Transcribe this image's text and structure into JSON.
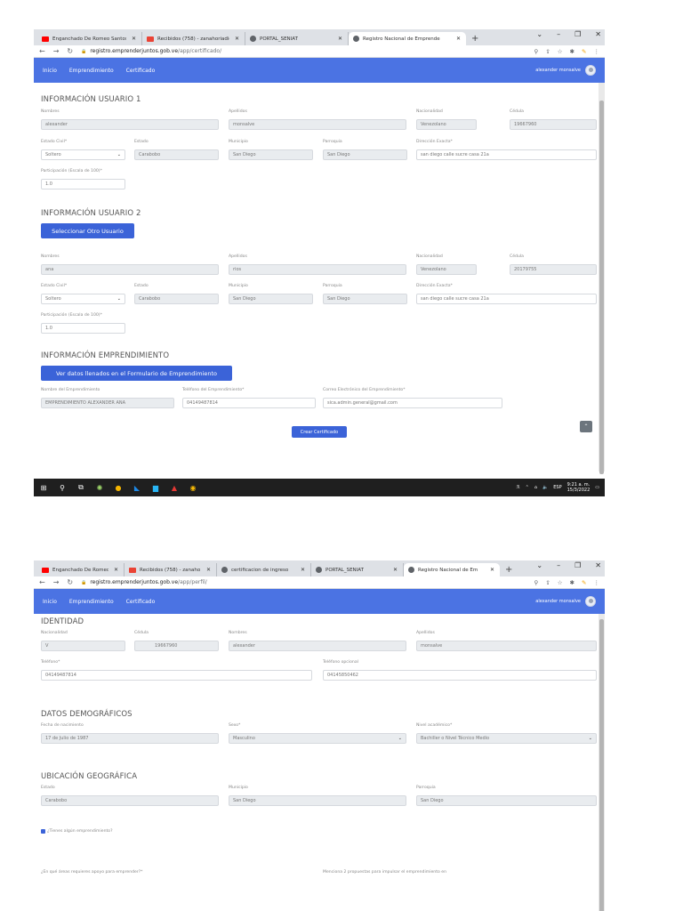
{
  "screenshot1": {
    "tabs": [
      {
        "title": "Enganchado De Romeo Santos",
        "icon": "youtube-icon",
        "color": "#ff0000",
        "active": false
      },
      {
        "title": "Recibidos (758) - zanahoriadigit",
        "icon": "gmail-icon",
        "color": "#ea4335",
        "active": false
      },
      {
        "title": "PORTAL_SENIAT",
        "icon": "globe-icon",
        "color": "#5f6368",
        "active": false
      },
      {
        "title": "Registro Nacional de Emprende",
        "icon": "globe-icon",
        "color": "#5f6368",
        "active": true
      }
    ],
    "url_host": "registro.emprenderjuntos.gob.ve",
    "url_path": "/app/certificado/",
    "nav": [
      "Inicio",
      "Emprendimiento",
      "Certificado"
    ],
    "user_name": "alexander monsalve",
    "section_user1": "INFORMACIÓN USUARIO 1",
    "section_user2": "INFORMACIÓN USUARIO 2",
    "section_emp": "INFORMACIÓN EMPRENDIMIENTO",
    "labels": {
      "nombres": "Nombres",
      "apellidos": "Apellidos",
      "nacionalidad": "Nacionalidad",
      "cedula": "Cédula",
      "estado_civil": "Estado Civil*",
      "estado": "Estado",
      "municipio": "Municipio",
      "parroquia": "Parroquia",
      "direccion": "Dirección Exacta*",
      "participacion": "Participación (Escala de 100)*",
      "nombre_emp": "Nombre del Emprendimiento",
      "telefono_emp": "Teléfono del Emprendimiento*",
      "correo_emp": "Correo Electrónico del Emprendimiento*"
    },
    "user1": {
      "nombres": "alexander",
      "apellidos": "monsalve",
      "nacionalidad": "Venezolano",
      "cedula": "19667960",
      "estado_civil": "Soltero",
      "estado": "Carabobo",
      "municipio": "San Diego",
      "parroquia": "San Diego",
      "direccion": "san diego calle sucre casa 21a",
      "participacion": "1.0"
    },
    "user2": {
      "nombres": "ana",
      "apellidos": "rios",
      "nacionalidad": "Venezolano",
      "cedula": "20179755",
      "estado_civil": "Soltero",
      "estado": "Carabobo",
      "municipio": "San Diego",
      "parroquia": "San Diego",
      "direccion": "san diego calle sucre casa 21a",
      "participacion": "1.0"
    },
    "btn_select_user": "Seleccionar Otro Usuario",
    "btn_view_form": "Ver datos llenados en el Formulario de Emprendimiento",
    "emp": {
      "nombre": "EMPRENDIMIENTO ALEXANDER ANA",
      "telefono": "04149487814",
      "correo": "sica.admin.general@gmail.com"
    },
    "btn_create_cert": "Crear Certificado",
    "tray": {
      "lang": "ESP",
      "time": "9:21 a. m.",
      "date": "15/3/2022"
    }
  },
  "screenshot2": {
    "tabs": [
      {
        "title": "Enganchado De Romeo Santos",
        "icon": "youtube-icon",
        "color": "#ff0000",
        "active": false
      },
      {
        "title": "Recibidos (758) - zanaho",
        "icon": "gmail-icon",
        "color": "#ea4335",
        "active": false
      },
      {
        "title": "certificacion de ingreso",
        "icon": "globe-icon",
        "color": "#5f6368",
        "active": false
      },
      {
        "title": "PORTAL_SENIAT",
        "icon": "globe-icon",
        "color": "#5f6368",
        "active": false
      },
      {
        "title": "Registro Nacional de Em",
        "icon": "globe-icon",
        "color": "#5f6368",
        "active": true
      }
    ],
    "url_host": "registro.emprenderjuntos.gob.ve",
    "url_path": "/app/perfil/",
    "nav": [
      "Inicio",
      "Emprendimiento",
      "Certificado"
    ],
    "user_name": "alexander monsalve",
    "section_identidad": "IDENTIDAD",
    "section_demo": "DATOS DEMOGRÁFICOS",
    "section_geo": "UBICACIÓN GEOGRÁFICA",
    "labels": {
      "nacionalidad": "Nacionalidad",
      "cedula": "Cédula",
      "nombres": "Nombres",
      "apellidos": "Apellidos",
      "telefono": "Teléfono*",
      "telefono_opc": "Teléfono opcional",
      "fecha_nac": "Fecha de nacimiento",
      "sexo": "Sexo*",
      "nivel": "Nivel académico*",
      "estado": "Estado",
      "municipio": "Municipio",
      "parroquia": "Parroquia",
      "areas": "¿En qué áreas requieres apoyo para emprender?*",
      "propuestas": "Menciona 2 propuestas para impulsar el emprendimiento en"
    },
    "values": {
      "nacionalidad": "V",
      "cedula": "19667960",
      "nombres": "alexander",
      "apellidos": "monsalve",
      "telefono": "04149487814",
      "telefono_opc": "04145850462",
      "fecha_nac": "17 de Julio de 1987",
      "sexo": "Masculino",
      "nivel": "Bachiller o Nivel Técnico Medio",
      "estado": "Carabobo",
      "municipio": "San Diego",
      "parroquia": "San Diego"
    },
    "checkbox_label": "¿Tienes algún emprendimiento?"
  }
}
